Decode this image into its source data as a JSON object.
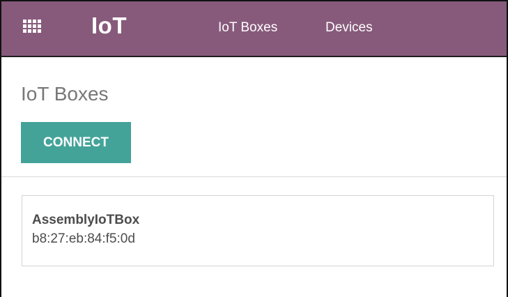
{
  "navbar": {
    "apps_icon": "grid-icon",
    "brand": "IoT",
    "menu": [
      {
        "label": "IoT Boxes"
      },
      {
        "label": "Devices"
      }
    ],
    "background_color": "#875a7b"
  },
  "control_panel": {
    "title": "IoT Boxes",
    "connect_label": "CONNECT",
    "accent_color": "#43a399"
  },
  "boxes": [
    {
      "name": "AssemblyIoTBox",
      "identifier": "b8:27:eb:84:f5:0d"
    }
  ]
}
